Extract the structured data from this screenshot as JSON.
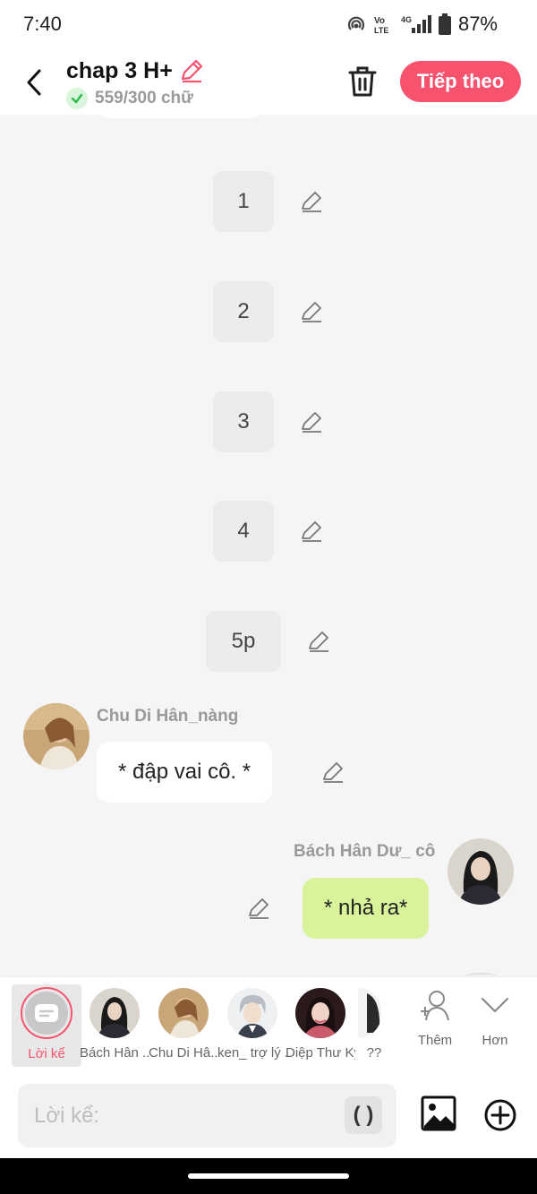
{
  "status_bar": {
    "time": "7:40",
    "battery": "87%",
    "network": "4G"
  },
  "header": {
    "title": "chap 3 H+",
    "word_count": "559/300 chữ",
    "next_label": "Tiếp theo"
  },
  "narrations": [
    {
      "text": "1"
    },
    {
      "text": "2"
    },
    {
      "text": "3"
    },
    {
      "text": "4"
    },
    {
      "text": "5p"
    }
  ],
  "messages": [
    {
      "speaker": "Chu Di Hân_nàng",
      "text": "* đập vai cô. *",
      "side": "left"
    },
    {
      "speaker": "Bách Hân Dư_ cô",
      "text": "* nhả ra*",
      "side": "right"
    }
  ],
  "character_strip": {
    "items": [
      {
        "label": "Lời kể",
        "selected": true
      },
      {
        "label": "Bách Hân ..."
      },
      {
        "label": "Chu Di Hâ..."
      },
      {
        "label": "ken_ trợ lý ..."
      },
      {
        "label": "Diệp Thư Kỳ"
      },
      {
        "label": "??"
      }
    ],
    "more_label": "Thêm",
    "expand_label": "Hơn"
  },
  "composer": {
    "placeholder": "Lời kể:",
    "paren_label": "( )"
  },
  "colors": {
    "accent": "#f7536e",
    "right_bubble": "#d8f39a",
    "background": "#f5f5f5"
  }
}
